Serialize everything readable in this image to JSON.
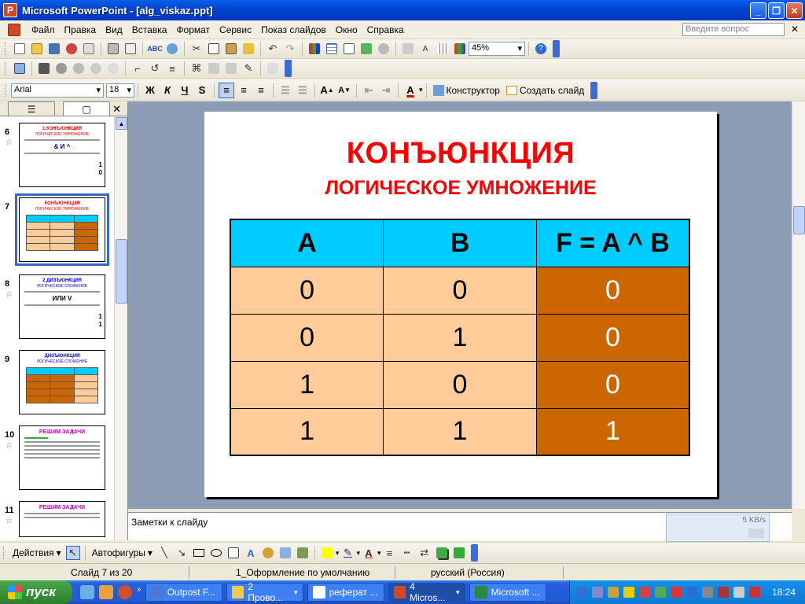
{
  "window": {
    "title": "Microsoft PowerPoint - [alg_viskaz.ppt]"
  },
  "menu": {
    "items": [
      "Файл",
      "Правка",
      "Вид",
      "Вставка",
      "Формат",
      "Сервис",
      "Показ слайдов",
      "Окно",
      "Справка"
    ],
    "help_placeholder": "Введите вопрос"
  },
  "toolbar": {
    "zoom": "45%",
    "font": "Arial",
    "size": "18",
    "bold": "Ж",
    "italic": "К",
    "underline": "Ч",
    "shadow": "S",
    "designer": "Конструктор",
    "new_slide": "Создать слайд"
  },
  "left_panel": {
    "slides": [
      {
        "num": "6",
        "title": "1.КОНЪЮНКЦИЯ",
        "sub": "ЛОГИЧЕСКОЕ УМНОЖЕНИЕ",
        "symbols": "& И ^",
        "r1": "1",
        "r2": "0"
      },
      {
        "num": "7",
        "title": "КОНЪЮНКЦИЯ",
        "sub": "ЛОГИЧЕСКОЕ УМНОЖЕНИЕ"
      },
      {
        "num": "8",
        "title": "2.ДИЗЪЮНКЦИЯ",
        "sub": "ЛОГИЧЕСКОЕ СЛОЖЕНИЕ",
        "symbols": "ИЛИ V",
        "r1": "1",
        "r2": "1"
      },
      {
        "num": "9",
        "title": "ДИЗЪЮНКЦИЯ",
        "sub": "ЛОГИЧЕСКОЕ СЛОЖЕНИЕ"
      },
      {
        "num": "10",
        "title": "РЕШИМ ЗАДАЧИ"
      },
      {
        "num": "11",
        "title": "РЕШИМ ЗАДАЧИ"
      }
    ]
  },
  "slide": {
    "title": "КОНЪЮНКЦИЯ",
    "subtitle": "ЛОГИЧЕСКОЕ УМНОЖЕНИЕ",
    "table": {
      "headers": [
        "A",
        "B",
        "F = A ^ B"
      ],
      "rows": [
        [
          "0",
          "0",
          "0"
        ],
        [
          "0",
          "1",
          "0"
        ],
        [
          "1",
          "0",
          "0"
        ],
        [
          "1",
          "1",
          "1"
        ]
      ]
    },
    "colors": {
      "title": "#ff0000",
      "header_bg": "#00ccff",
      "cell_bg": "#ffcc99",
      "result_bg": "#cc6600"
    }
  },
  "notes": {
    "placeholder": "Заметки к слайду"
  },
  "net_widget": {
    "speed": "5 KB/s"
  },
  "drawbar": {
    "actions": "Действия",
    "autoshapes": "Автофигуры"
  },
  "status": {
    "slide": "Слайд 7 из 20",
    "design": "1_Оформление по умолчанию",
    "lang": "русский (Россия)"
  },
  "taskbar": {
    "start": "пуск",
    "tasks": [
      "Outpost F...",
      "2 Прово...",
      "реферат ...",
      "4 Micros...",
      "Microsoft ..."
    ],
    "clock": "18:24"
  }
}
